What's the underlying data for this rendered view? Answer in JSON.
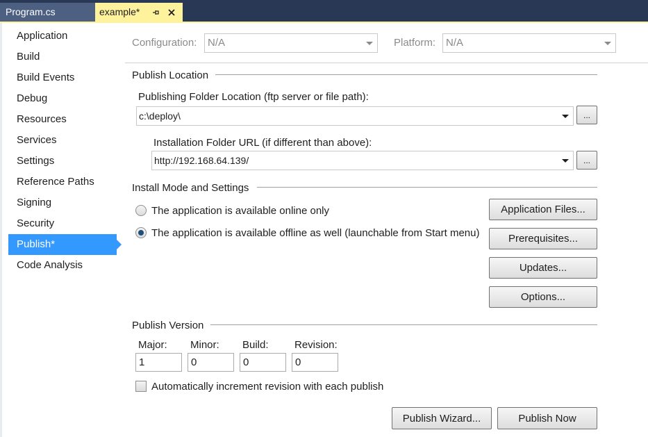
{
  "tabs": {
    "program": "Program.cs",
    "example": "example*"
  },
  "nav": {
    "items": [
      {
        "label": "Application"
      },
      {
        "label": "Build"
      },
      {
        "label": "Build Events"
      },
      {
        "label": "Debug"
      },
      {
        "label": "Resources"
      },
      {
        "label": "Services"
      },
      {
        "label": "Settings"
      },
      {
        "label": "Reference Paths"
      },
      {
        "label": "Signing"
      },
      {
        "label": "Security"
      },
      {
        "label": "Publish*",
        "selected": true
      },
      {
        "label": "Code Analysis"
      }
    ]
  },
  "config": {
    "configuration_label": "Configuration:",
    "configuration_value": "N/A",
    "platform_label": "Platform:",
    "platform_value": "N/A"
  },
  "publish_location": {
    "title": "Publish Location",
    "folder_label": "Publishing Folder Location (ftp server or file path):",
    "folder_value": "c:\\deploy\\",
    "install_label": "Installation Folder URL (if different than above):",
    "install_value": "http://192.168.64.139/",
    "browse_label": "..."
  },
  "install_mode": {
    "title": "Install Mode and Settings",
    "online_label": "The application is available online only",
    "offline_label": "The application is available offline as well (launchable from Start menu)",
    "selected": "offline",
    "buttons": {
      "application_files": "Application Files...",
      "prerequisites": "Prerequisites...",
      "updates": "Updates...",
      "options": "Options..."
    }
  },
  "publish_version": {
    "title": "Publish Version",
    "major_label": "Major:",
    "minor_label": "Minor:",
    "build_label": "Build:",
    "revision_label": "Revision:",
    "major": "1",
    "minor": "0",
    "build": "0",
    "revision": "0",
    "auto_increment_label": "Automatically increment revision with each publish",
    "auto_increment_checked": false
  },
  "actions": {
    "publish_wizard": "Publish Wizard...",
    "publish_now": "Publish Now"
  },
  "colors": {
    "tabstrip": "#293955",
    "active_tab": "#fff29d",
    "nav_selected": "#3399ff"
  },
  "icons": {
    "pin": "pin-icon",
    "close": "close-icon",
    "dropdown": "chevron-down-icon"
  }
}
